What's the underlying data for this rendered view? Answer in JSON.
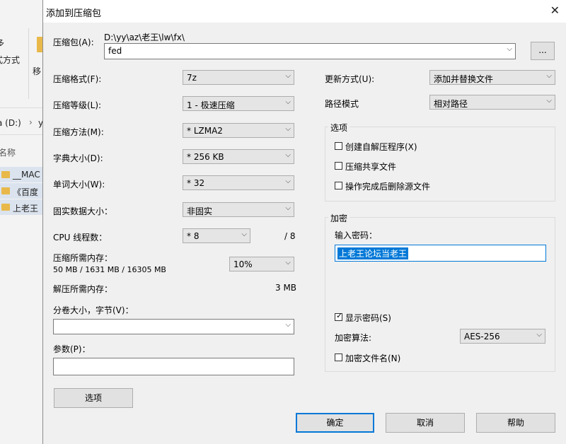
{
  "background": {
    "frag1": "多",
    "frag2": "式方式",
    "frag3": "移",
    "drive": "a (D:)",
    "frag4": "y",
    "col_name": "名称",
    "files": [
      "__MAC",
      "《百度",
      "上老王"
    ]
  },
  "dialog": {
    "title": "添加到压缩包",
    "archive": {
      "label": "压缩包(A):",
      "path": "D:\\yy\\az\\老王\\lw\\fx\\",
      "value": "fed",
      "browse": "..."
    },
    "left": {
      "format": {
        "label": "压缩格式(F):",
        "value": "7z"
      },
      "level": {
        "label": "压缩等级(L):",
        "value": "1 - 极速压缩"
      },
      "method": {
        "label": "压缩方法(M):",
        "value": "* LZMA2"
      },
      "dict": {
        "label": "字典大小(D):",
        "value": "* 256 KB"
      },
      "word": {
        "label": "单词大小(W):",
        "value": "* 32"
      },
      "solid": {
        "label": "固实数据大小：",
        "value": "非固实"
      },
      "threads": {
        "label": "CPU 线程数：",
        "value": "* 8",
        "max": "/ 8"
      },
      "mem_comp": {
        "label": "压缩所需内存：",
        "detail": "50 MB / 1631 MB / 16305 MB",
        "value": "10%"
      },
      "mem_decomp": {
        "label": "解压所需内存：",
        "value": "3 MB"
      },
      "volume": {
        "label": "分卷大小，字节(V)：",
        "value": ""
      },
      "params": {
        "label": "参数(P)：",
        "value": ""
      },
      "options_button": "选项"
    },
    "right": {
      "update": {
        "label": "更新方式(U):",
        "value": "添加并替换文件"
      },
      "pathmode": {
        "label": "路径模式",
        "value": "相对路径"
      },
      "options": {
        "title": "选项",
        "sfx": "创建自解压程序(X)",
        "shared": "压缩共享文件",
        "delete": "操作完成后删除源文件"
      },
      "encryption": {
        "title": "加密",
        "pw_label": "输入密码：",
        "password": "上老王论坛当老王",
        "show_pw": "显示密码(S)",
        "method_label": "加密算法:",
        "method": "AES-256",
        "encrypt_names": "加密文件名(N)"
      }
    },
    "buttons": {
      "ok": "确定",
      "cancel": "取消",
      "help": "帮助"
    }
  }
}
